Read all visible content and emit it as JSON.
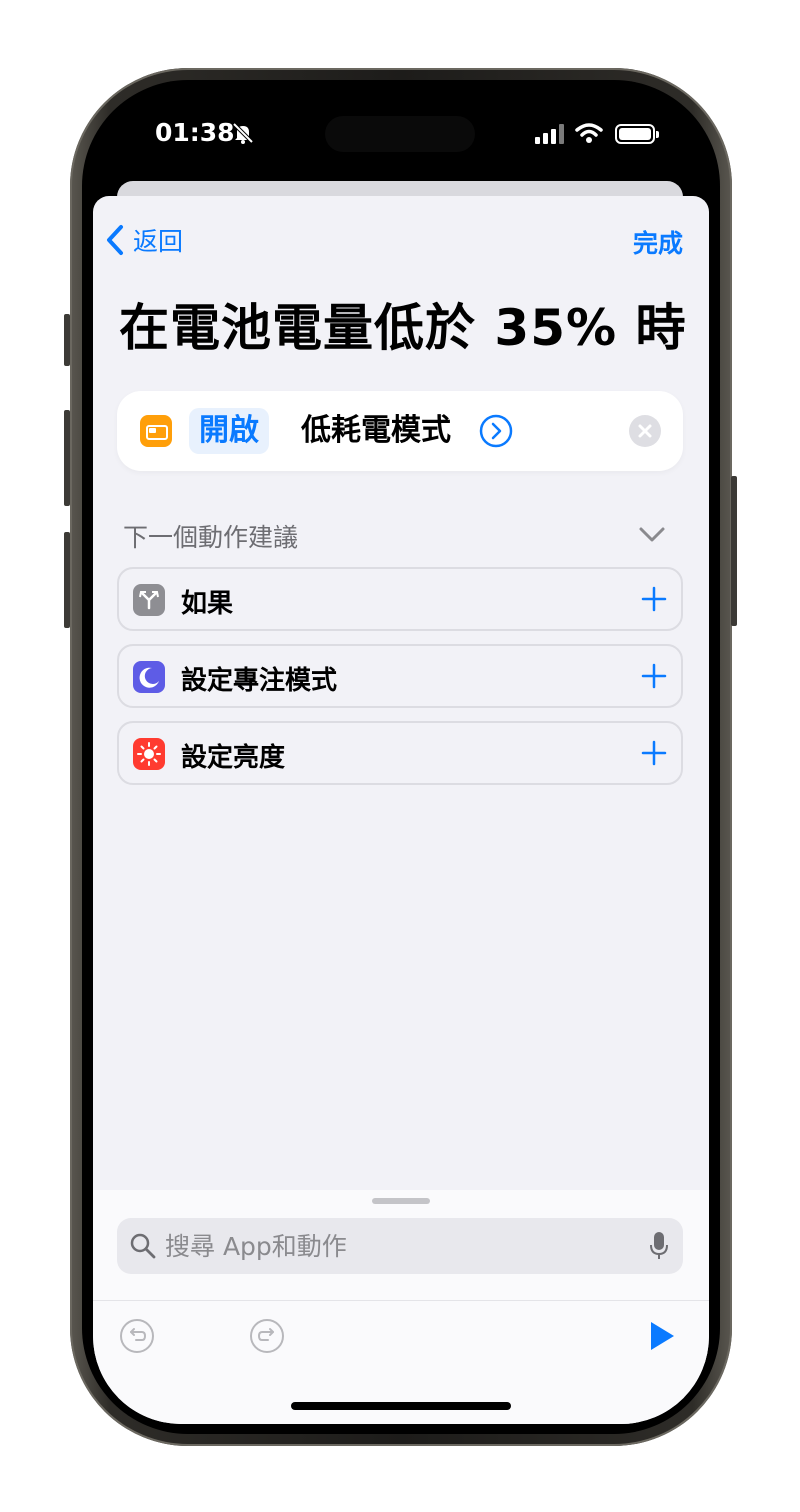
{
  "status_bar": {
    "time": "01:38"
  },
  "nav": {
    "back_label": "返回",
    "done_label": "完成"
  },
  "page": {
    "title": "在電池電量低於 35% 時"
  },
  "action": {
    "param_value": "開啟",
    "label": "低耗電模式"
  },
  "suggestions": {
    "header": "下一個動作建議",
    "items": [
      {
        "label": "如果",
        "icon": "branch-icon",
        "color": "#8e8e93"
      },
      {
        "label": "設定專注模式",
        "icon": "moon-icon",
        "color": "#5e5ce6"
      },
      {
        "label": "設定亮度",
        "icon": "sun-icon",
        "color": "#ff3b30"
      }
    ]
  },
  "search": {
    "placeholder": "搜尋 App和動作",
    "value": ""
  },
  "colors": {
    "accent": "#0a7aff",
    "battery_icon": "#ff9f0a",
    "background": "#f2f2f7"
  }
}
